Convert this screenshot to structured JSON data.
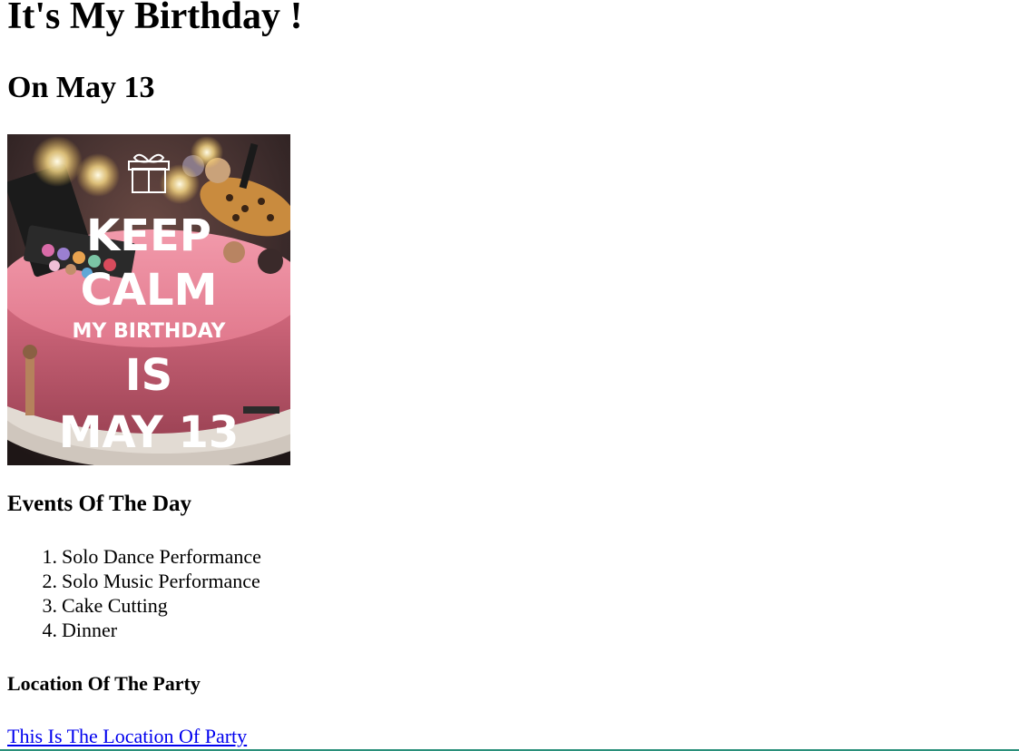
{
  "page": {
    "title": "It's My Birthday !",
    "subtitle": "On May 13"
  },
  "image": {
    "icon": "birthday-cake-image",
    "lines": [
      "KEEP",
      "CALM",
      "MY BIRTHDAY",
      "IS",
      "MAY 13"
    ],
    "colors": {
      "cake": "#e67e92",
      "cake_dark": "#b44f63",
      "background": "#3a2a2a",
      "plate": "#d9d3cc",
      "sparkler": "#fff4c2"
    }
  },
  "events": {
    "heading": "Events Of The Day",
    "items": [
      "Solo Dance Performance",
      "Solo Music Performance",
      "Cake Cutting",
      "Dinner"
    ]
  },
  "location": {
    "heading": "Location Of The Party",
    "link_text": "This Is The Location Of Party"
  },
  "colors": {
    "link": "#0000ee",
    "text": "#000000",
    "background": "#ffffff"
  }
}
